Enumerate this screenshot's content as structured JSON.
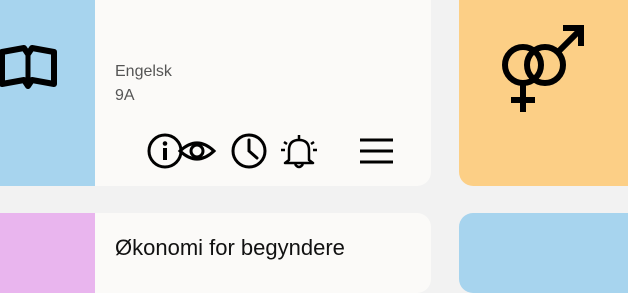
{
  "cards": [
    {
      "icon": "book-icon",
      "subject": "Engelsk",
      "class_name": "9A",
      "thumb_color": "#a7d4ee",
      "actions": [
        {
          "icon": "info-icon"
        },
        {
          "icon": "eye-icon"
        },
        {
          "icon": "clock-icon"
        },
        {
          "icon": "alarm-bell-icon"
        },
        {
          "icon": "menu-icon"
        }
      ]
    },
    {
      "icon": "gender-symbols-icon",
      "thumb_color": "#fccf86"
    },
    {
      "title": "Økonomi for begyndere",
      "thumb_color": "#e9b5ee"
    },
    {
      "thumb_color": "#a7d4ee"
    }
  ]
}
